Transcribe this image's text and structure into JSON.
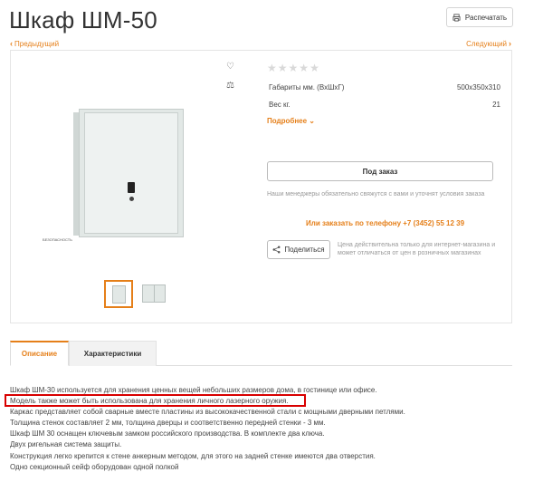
{
  "header": {
    "title": "Шкаф ШМ-50",
    "print_label": "Распечатать"
  },
  "navigation": {
    "prev_label": "Предыдущий",
    "next_label": "Следующий"
  },
  "gallery": {
    "safe_label": "БЕЗОПАСНОСТЬ",
    "thumbnails": 2,
    "selected_thumbnail": 1
  },
  "product": {
    "rating_stars": 5,
    "rating_value": 0,
    "specs": [
      {
        "name": "Габариты мм. (ВхШхГ)",
        "value": "500х350х310"
      },
      {
        "name": "Вес кг.",
        "value": "21"
      }
    ],
    "more_label": "Подробнее",
    "order_button": "Под заказ",
    "manager_note": "Наши менеджеры обязательно свяжутся с вами и уточнят условия заказа",
    "phone_line": "Или заказать по телефону +7 (3452) 55 12 39",
    "share_label": "Поделиться",
    "price_note": "Цена действительна только для интернет-магазина и может отличаться от цен в розничных магазинах"
  },
  "tabs": [
    {
      "label": "Описание",
      "active": true
    },
    {
      "label": "Характеристики",
      "active": false
    }
  ],
  "description": [
    "Шкаф ШМ-30 используется для хранения ценных вещей небольших размеров дома, в гостинице или офисе.",
    "Модель также может быть использована для хранения личного лазерного оружия.",
    "Каркас представляет собой сварные вместе пластины из высококачественной стали с мощными дверными петлями.",
    "Толщина стенок составляет 2 мм, толщина дверцы и соответственно передней стенки - 3 мм.",
    "Шкаф ШМ 30 оснащен ключевым замком российского производства. В комплекте два ключа.",
    "Двух ригельная система защиты.",
    "Конструкция легко крепится к стене анкерным методом, для этого на задней стенке имеются два отверстия.",
    "Одно секционный сейф оборудован одной полкой"
  ],
  "colors": {
    "accent": "#e57f19",
    "highlight": "#d80000"
  }
}
